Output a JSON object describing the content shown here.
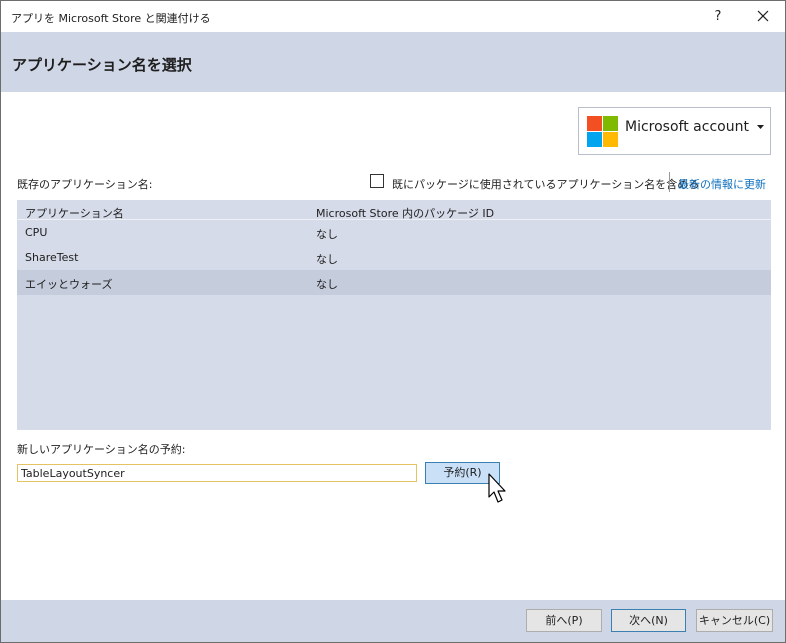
{
  "window": {
    "title": "アプリを Microsoft Store と関連付ける",
    "help_glyph": "?"
  },
  "header": {
    "title": "アプリケーション名を選択"
  },
  "account": {
    "label": "Microsoft account",
    "logo_colors": [
      "#f25022",
      "#7fba00",
      "#00a4ef",
      "#ffb900"
    ]
  },
  "existing": {
    "label": "既存のアプリケーション名:",
    "include_checkbox_label": "既にパッケージに使用されているアプリケーション名を含める",
    "include_checked": false,
    "refresh_link": "最新の情報に更新"
  },
  "grid": {
    "columns": [
      "アプリケーション名",
      "Microsoft Store 内のパッケージ ID"
    ],
    "rows": [
      {
        "name": "CPU",
        "package_id": "なし"
      },
      {
        "name": "ShareTest",
        "package_id": "なし"
      },
      {
        "name": "エイッとウォーズ",
        "package_id": "なし"
      }
    ],
    "selected_row": 2
  },
  "reserve": {
    "label": "新しいアプリケーション名の予約:",
    "input_value": "TableLayoutSyncer",
    "button_label": "予約(R)"
  },
  "footer": {
    "back_label": "前へ(P)",
    "next_label": "次へ(N)",
    "cancel_label": "キャンセル(C)"
  },
  "colors": {
    "band": "#cfd6e5",
    "grid_bg": "#d6dbe9",
    "selected_row": "#c5ccdc",
    "link": "#0e70c0",
    "accent_border": "#3c7fb1",
    "input_border": "#e5c365"
  }
}
